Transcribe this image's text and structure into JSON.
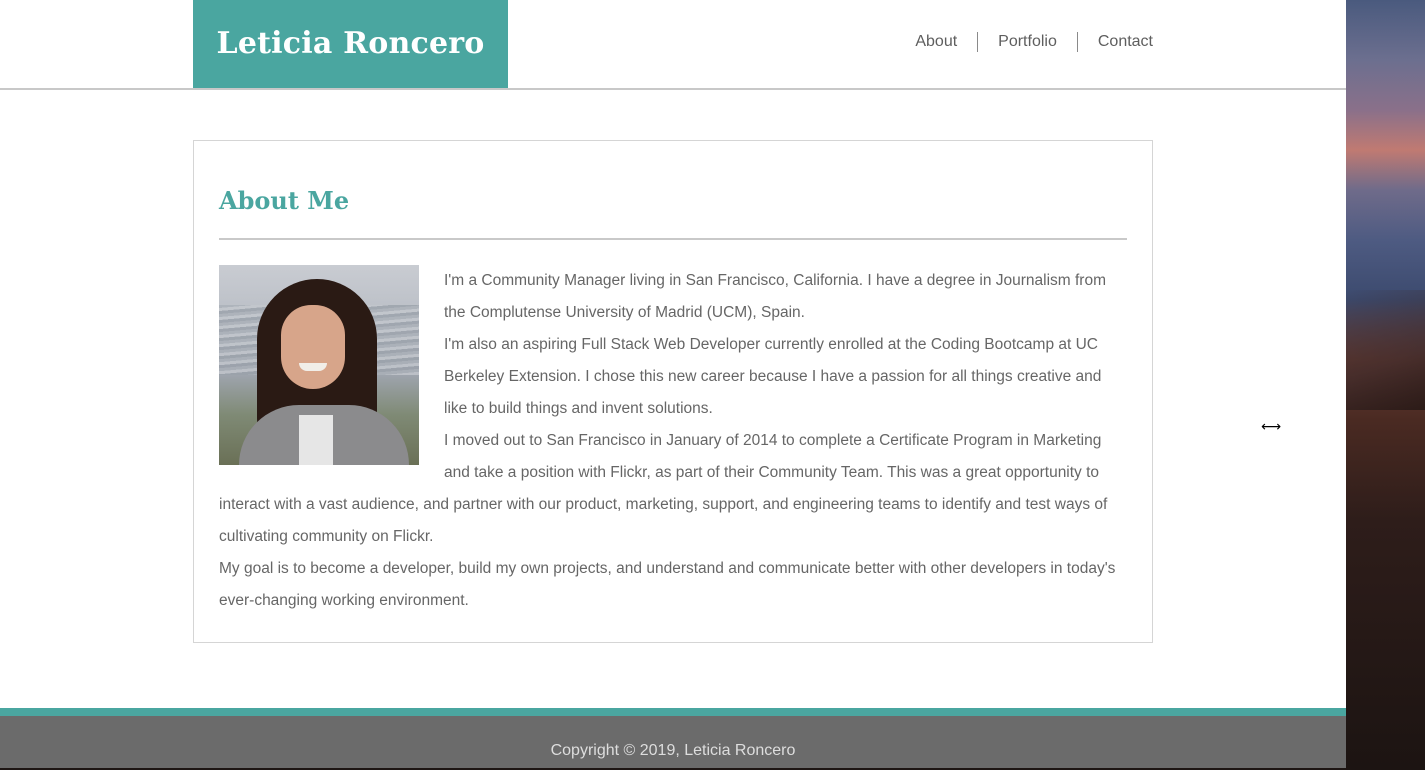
{
  "header": {
    "brand": "Leticia Roncero",
    "nav": [
      {
        "label": "About"
      },
      {
        "label": "Portfolio"
      },
      {
        "label": "Contact"
      }
    ]
  },
  "about": {
    "title": "About Me",
    "photo_alt": "photo-of-leticia",
    "paragraphs": [
      "I'm a Community Manager living in San Francisco, California. I have a degree in Journalism from the Complutense University of Madrid (UCM), Spain.",
      "I'm also an aspiring Full Stack Web Developer currently enrolled at the Coding Bootcamp at UC Berkeley Extension. I chose this new career because I have a passion for all things creative and like to build things and invent solutions.",
      "I moved out to San Francisco in January of 2014 to complete a Certificate Program in Marketing and take a position with Flickr, as part of their Community Team. This was a great opportunity to interact with a vast audience, and partner with our product, marketing, support, and engineering teams to identify and test ways of cultivating community on Flickr.",
      "My goal is to become a developer, build my own projects, and understand and communicate better with other developers in today's ever-changing working environment."
    ]
  },
  "footer": {
    "copyright": "Copyright © 2019, Leticia Roncero"
  },
  "colors": {
    "accent": "#4aa6a0",
    "footer_bg": "#6b6b6b",
    "text": "#666666"
  },
  "cursor": {
    "icon": "resize-horizontal-icon",
    "glyph": "⟷"
  }
}
